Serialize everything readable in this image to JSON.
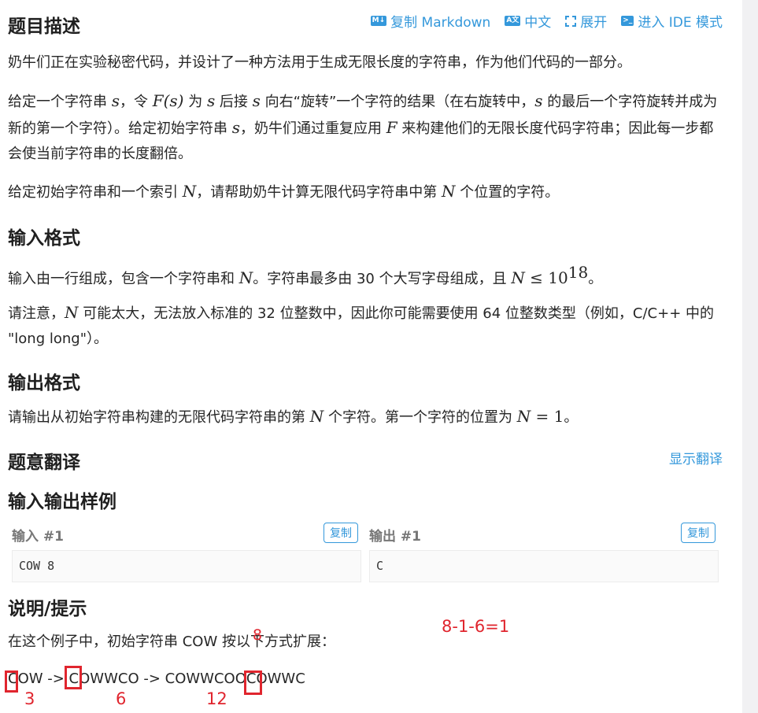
{
  "toolbar": {
    "copy_markdown": "复制 Markdown",
    "chinese": "中文",
    "expand": "展开",
    "ide_mode": "进入 IDE 模式",
    "markdown_icon_text": "M↓",
    "lang_icon_text": "A文",
    "ide_icon_text": ">_"
  },
  "headings": {
    "description": "题目描述",
    "input_format": "输入格式",
    "output_format": "输出格式",
    "translation": "题意翻译",
    "samples": "输入输出样例",
    "hint": "说明/提示"
  },
  "description": {
    "p1": "奶牛们正在实验秘密代码，并设计了一种方法用于生成无限长度的字符串，作为他们代码的一部分。",
    "p2_a": "给定一个字符串 ",
    "p2_s1": "s",
    "p2_b": "，令 ",
    "p2_F": "F(s)",
    "p2_c": " 为 ",
    "p2_s2": "s",
    "p2_d": " 后接 ",
    "p2_s3": "s",
    "p2_e": " 向右“旋转”一个字符的结果（在右旋转中，",
    "p2_s4": "s",
    "p2_f": " 的最后一个字符旋转并成为新的第一个字符）。给定初始字符串 ",
    "p2_s5": "s",
    "p2_g": "，奶牛们通过重复应用 ",
    "p2_F2": "F",
    "p2_h": " 来构建他们的无限长度代码字符串；因此每一步都会使当前字符串的长度翻倍。",
    "p3_a": "给定初始字符串和一个索引 ",
    "p3_N1": "N",
    "p3_b": "，请帮助奶牛计算无限代码字符串中第 ",
    "p3_N2": "N",
    "p3_c": " 个位置的字符。"
  },
  "input_format": {
    "p1_a": "输入由一行组成，包含一个字符串和 ",
    "p1_N": "N",
    "p1_b": "。字符串最多由 30 个大写字母组成，且 ",
    "p1_N2": "N",
    "p1_le": " ≤ 10",
    "p1_exp": "18",
    "p1_c": "。",
    "p2_a": "请注意，",
    "p2_N": "N",
    "p2_b": " 可能太大，无法放入标准的 32 位整数中，因此你可能需要使用 64 位整数类型（例如，C/C++ 中的 \"long long\"）。"
  },
  "output_format": {
    "p1_a": "请输出从初始字符串构建的无限代码字符串的第 ",
    "p1_N": "N",
    "p1_b": " 个字符。第一个字符的位置为 ",
    "p1_N2": "N",
    "p1_eq": " = 1",
    "p1_c": "。"
  },
  "translation": {
    "show_link": "显示翻译"
  },
  "samples": {
    "input_label": "输入 #1",
    "output_label": "输出 #1",
    "copy_label": "复制",
    "input_value": "COW 8",
    "output_value": "C"
  },
  "hint": {
    "p1": "在这个例子中，初始字符串 COW 按以下方式扩展：",
    "expansion": "COW -> COWWCO -> COWWCOOCOWWC"
  },
  "annotations": {
    "calc": "8-1-6=1",
    "eight": "8",
    "three": "3",
    "six": "6",
    "twelve": "12",
    "color": "#e0252e"
  },
  "colors": {
    "link": "#3498db",
    "text": "#262626"
  }
}
